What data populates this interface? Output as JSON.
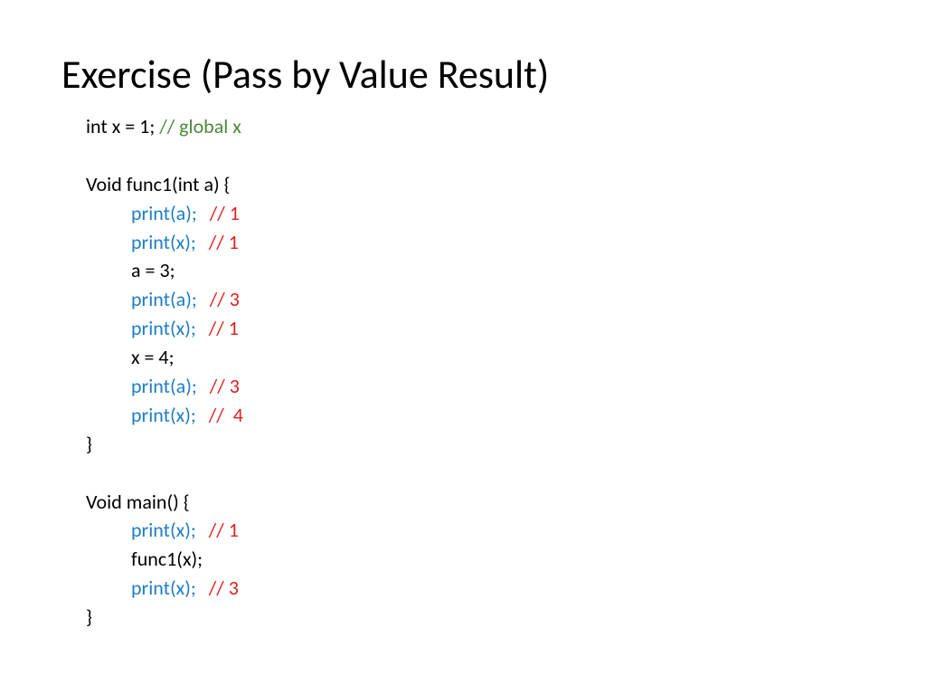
{
  "title": "Exercise (Pass by Value Result)",
  "lines": {
    "l0a": "int x = 1; ",
    "l0b": "// global x",
    "blank": " ",
    "l1": "Void func1(int a) {",
    "pa": "print(a);",
    "px": "print(x);",
    "c1": "// 1",
    "c3": "// 3",
    "c4": "//  4",
    "a3": "a = 3;",
    "x4": "x = 4;",
    "close": "}",
    "vmain": "Void main() {",
    "func1x": "func1(x);"
  }
}
